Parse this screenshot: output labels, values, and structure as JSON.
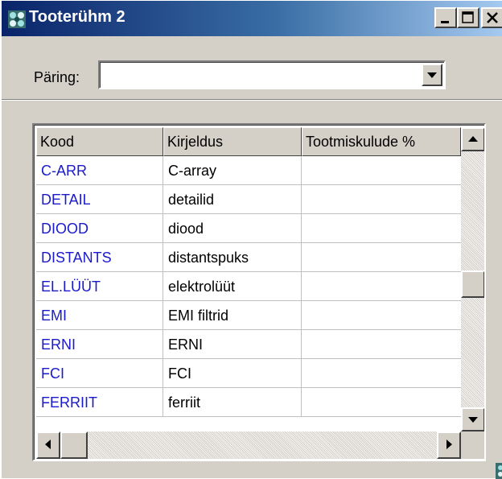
{
  "window": {
    "title": "Tooterühm 2",
    "controls": {
      "minimize": "minimize-icon",
      "maximize": "maximize-icon",
      "close": "close-icon"
    }
  },
  "query": {
    "label": "Päring:",
    "value": "",
    "dropdown_icon": "chevron-down-icon"
  },
  "grid": {
    "columns": [
      "Kood",
      "Kirjeldus",
      "Tootmiskulude %"
    ],
    "rows": [
      {
        "code": "C-ARR",
        "desc": "C-array",
        "pct": ""
      },
      {
        "code": "DETAIL",
        "desc": "detailid",
        "pct": ""
      },
      {
        "code": "DIOOD",
        "desc": "diood",
        "pct": ""
      },
      {
        "code": "DISTANTS",
        "desc": "distantspuks",
        "pct": ""
      },
      {
        "code": "EL.LÜÜT",
        "desc": "elektrolüüt",
        "pct": ""
      },
      {
        "code": "EMI",
        "desc": "EMI filtrid",
        "pct": ""
      },
      {
        "code": "ERNI",
        "desc": "ERNI",
        "pct": ""
      },
      {
        "code": "FCI",
        "desc": "FCI",
        "pct": ""
      },
      {
        "code": "FERRIIT",
        "desc": "ferriit",
        "pct": ""
      }
    ],
    "vertical_scroll_fraction": 0.6
  },
  "colors": {
    "code_text": "#1a1acc",
    "titlebar_start": "#0a246a",
    "titlebar_end": "#a6caf0",
    "face": "#d4d0c8"
  }
}
